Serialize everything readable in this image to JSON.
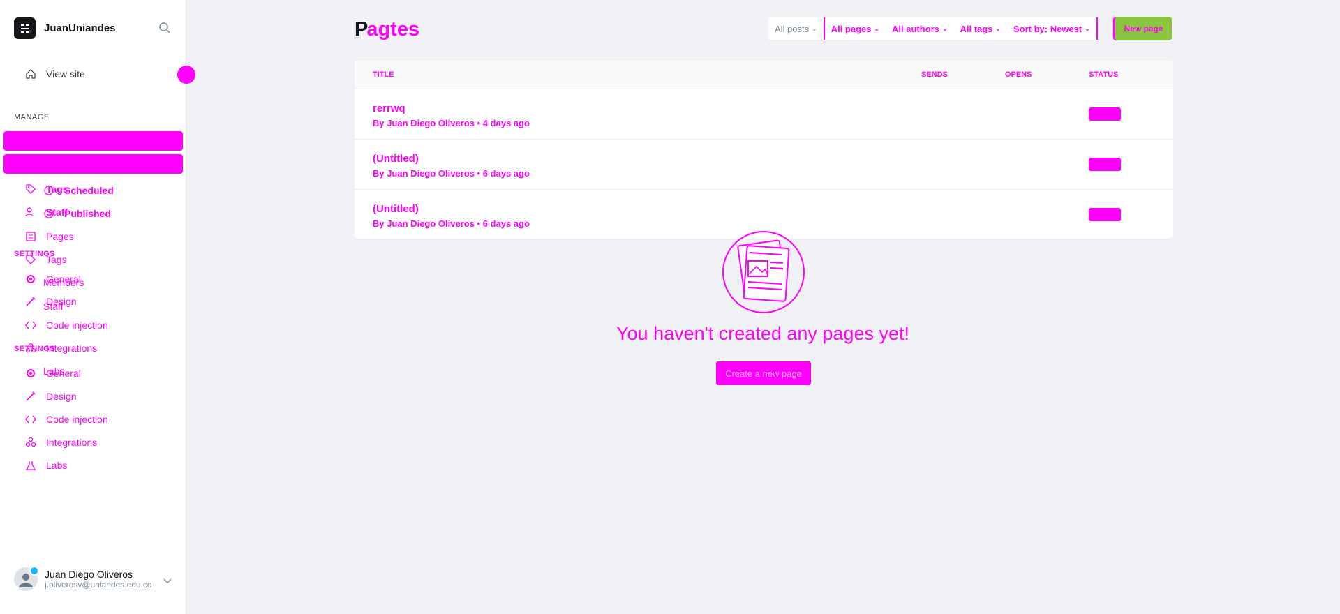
{
  "site": {
    "name": "JuanUniandes"
  },
  "sidebar": {
    "view_site": "View site",
    "manage_label": "MANAGE",
    "settings_label_a": "SETTINGS",
    "settings_label_b": "SETTINGS",
    "items": [
      {
        "label": "Tags",
        "icon": "tag-icon"
      },
      {
        "label": "Scheduled",
        "icon": "clock-icon"
      },
      {
        "label": "Staff",
        "icon": "staff-icon"
      },
      {
        "label": "Published",
        "icon": "check-icon"
      },
      {
        "label": "Pages",
        "icon": "pages-icon"
      },
      {
        "label": "Tags",
        "icon": "tag-icon"
      },
      {
        "label": "General",
        "icon": "gear-icon"
      },
      {
        "label": "Members",
        "icon": "members-icon"
      },
      {
        "label": "Design",
        "icon": "brush-icon"
      },
      {
        "label": "Staff",
        "icon": "staff-icon"
      },
      {
        "label": "Code injection",
        "icon": "code-icon"
      },
      {
        "label": "Integrations",
        "icon": "integrations-icon"
      },
      {
        "label": "Labs",
        "icon": "labs-icon"
      },
      {
        "label": "General",
        "icon": "gear-icon"
      },
      {
        "label": "Design",
        "icon": "brush-icon"
      },
      {
        "label": "Code injection",
        "icon": "code-icon"
      },
      {
        "label": "Integrations",
        "icon": "integrations-icon"
      },
      {
        "label": "Labs",
        "icon": "labs-icon"
      }
    ]
  },
  "user": {
    "name": "Juan Diego Oliveros",
    "email": "j.oliverosv@uniandes.edu.co"
  },
  "header": {
    "title_prefix": "P",
    "title_overlay": "agtes",
    "filters": [
      "All posts",
      "All pages",
      "All authors",
      "All tags",
      "Sort by: Newest"
    ],
    "new_button": "New page"
  },
  "table": {
    "columns": [
      "TITLE",
      "SENDS",
      "OPENS",
      "STATUS"
    ],
    "rows": [
      {
        "title": "rerrwq",
        "meta": "By Juan Diego Oliveros • 4 days ago"
      },
      {
        "title": "(Untitled)",
        "meta": "By Juan Diego Oliveros • 6 days ago"
      },
      {
        "title": "(Untitled)",
        "meta": "By Juan Diego Oliveros • 6 days ago"
      }
    ]
  },
  "empty_state": {
    "message": "You haven't created any pages yet!",
    "button": "Create a new page"
  },
  "colors": {
    "accent": "#ff00ff",
    "primary_green": "#8bc53f",
    "sidebar_bg": "#ffffff",
    "main_bg": "#f1f2f6"
  }
}
